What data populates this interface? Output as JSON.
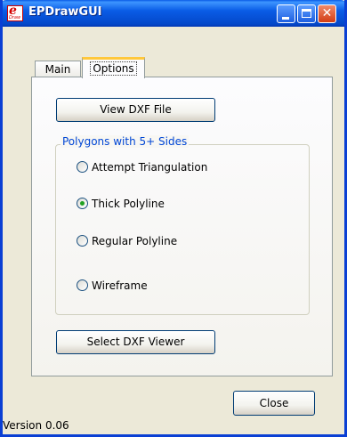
{
  "window": {
    "title": "EPDrawGUI",
    "logo_text": "e",
    "logo_subtext": "Draw"
  },
  "tabs": [
    {
      "label": "Main",
      "selected": false
    },
    {
      "label": "Options",
      "selected": true
    }
  ],
  "options": {
    "view_dxf_label": "View DXF File",
    "group_label": "Polygons with 5+ Sides",
    "radios": [
      {
        "label": "Attempt Triangulation",
        "checked": false
      },
      {
        "label": "Thick Polyline",
        "checked": true
      },
      {
        "label": "Regular Polyline",
        "checked": false
      },
      {
        "label": "Wireframe",
        "checked": false
      }
    ],
    "select_viewer_label": "Select DXF Viewer"
  },
  "footer": {
    "close_label": "Close",
    "version": "Version 0.06"
  },
  "colors": {
    "titlebar": "#0a5ce6",
    "group_label": "#0046d5",
    "radio_dot": "#21a121",
    "tab_highlight": "#ffc83c"
  }
}
